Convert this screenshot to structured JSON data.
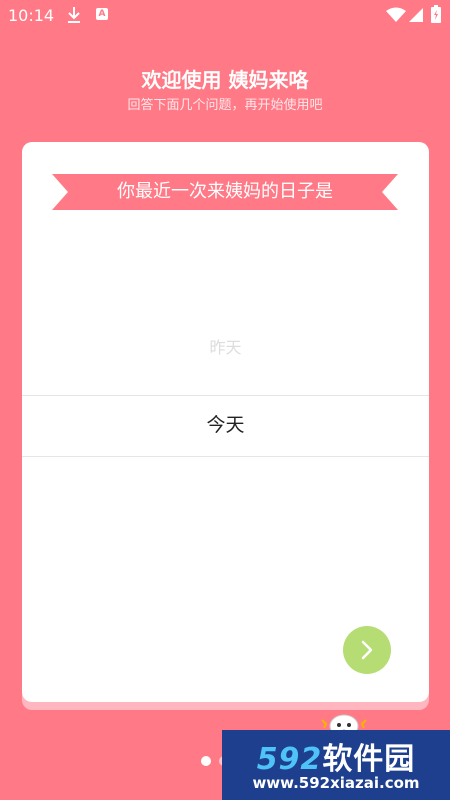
{
  "status_bar": {
    "time": "10:14",
    "notification_letter": "A",
    "icons": [
      "download-icon",
      "a-icon",
      "wifi-icon",
      "signal-icon",
      "battery-icon"
    ]
  },
  "header": {
    "title": "欢迎使用 姨妈来咯",
    "subtitle": "回答下面几个问题，再开始使用吧"
  },
  "card": {
    "question": "你最近一次来姨妈的日子是",
    "picker": {
      "previous_option": "昨天",
      "selected_option": "今天"
    },
    "next_icon": "chevron-right-icon"
  },
  "pagination": {
    "active_page": 1
  },
  "watermark": {
    "logo_digits": "592",
    "logo_text": "软件园",
    "url": "www.592xiazai.com"
  },
  "colors": {
    "background": "#FF7A86",
    "ribbon": "#FF7A86",
    "next_button": "#B5DD73",
    "card": "#FFFFFF"
  }
}
